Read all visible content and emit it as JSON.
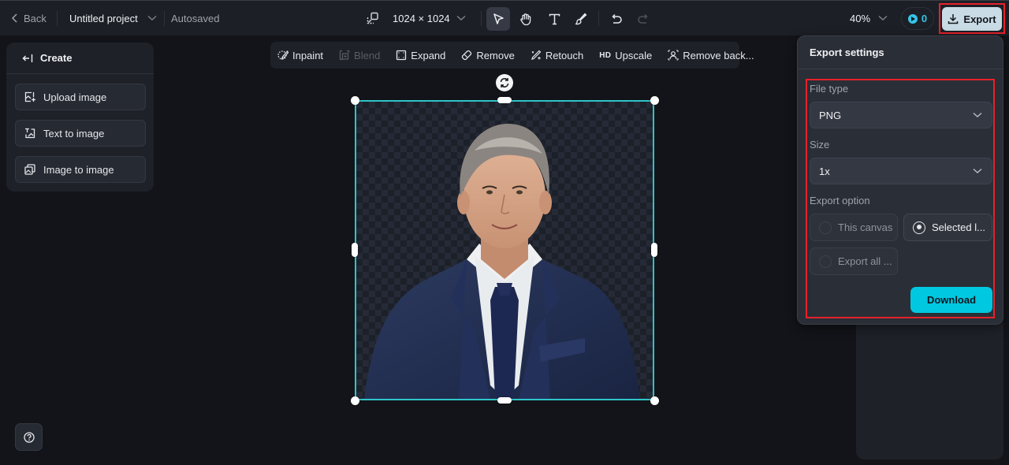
{
  "topbar": {
    "back_label": "Back",
    "project_name": "Untitled project",
    "save_status": "Autosaved",
    "canvas_size": "1024 × 1024",
    "tools": [
      {
        "name": "select",
        "icon": "cursor-arrow-icon",
        "active": true
      },
      {
        "name": "hand",
        "icon": "hand-icon",
        "active": false
      },
      {
        "name": "text",
        "icon": "text-icon",
        "active": false
      },
      {
        "name": "brush",
        "icon": "brush-icon",
        "active": false
      }
    ],
    "undo_icon": "undo-icon",
    "redo_icon": "redo-icon",
    "zoom_level": "40%",
    "credits": "0",
    "export_label": "Export"
  },
  "left_panel": {
    "header": "Create",
    "items": [
      {
        "label": "Upload image",
        "icon": "upload-image-icon"
      },
      {
        "label": "Text to image",
        "icon": "text-to-image-icon"
      },
      {
        "label": "Image to image",
        "icon": "image-to-image-icon"
      }
    ]
  },
  "edit_toolbar": {
    "items": [
      {
        "label": "Inpaint",
        "icon": "inpaint-icon",
        "disabled": false
      },
      {
        "label": "Blend",
        "icon": "blend-icon",
        "disabled": true
      },
      {
        "label": "Expand",
        "icon": "expand-icon",
        "disabled": false
      },
      {
        "label": "Remove",
        "icon": "eraser-icon",
        "disabled": false
      },
      {
        "label": "Retouch",
        "icon": "retouch-icon",
        "disabled": false
      },
      {
        "label": "Upscale",
        "icon": "hd-icon",
        "icon_text": "HD",
        "disabled": false
      },
      {
        "label": "Remove back...",
        "icon": "remove-background-icon",
        "disabled": false
      }
    ]
  },
  "export_settings": {
    "title": "Export settings",
    "file_type_label": "File type",
    "file_type_value": "PNG",
    "size_label": "Size",
    "size_value": "1x",
    "export_option_label": "Export option",
    "options": [
      {
        "label": "This canvas",
        "selected": false
      },
      {
        "label": "Selected l...",
        "selected": true
      },
      {
        "label": "Export all ...",
        "selected": false
      }
    ],
    "download_label": "Download"
  },
  "colors": {
    "accent": "#00c8e0",
    "selection": "#2ec4c8",
    "highlight": "#e8212b"
  }
}
